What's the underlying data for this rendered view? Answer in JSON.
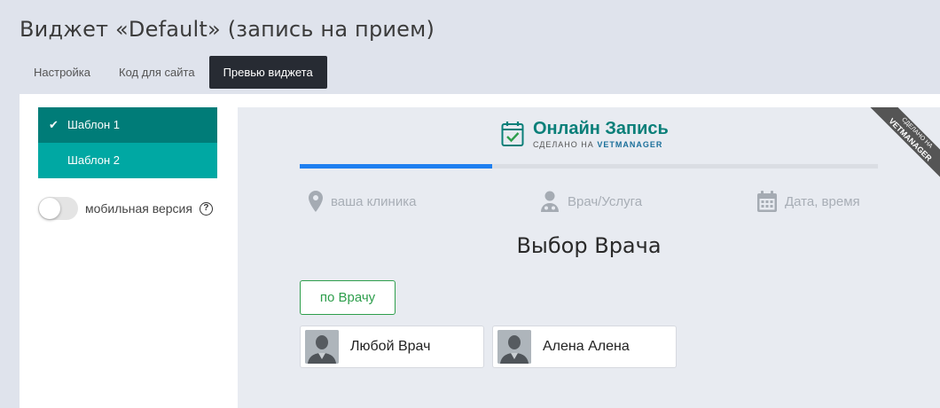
{
  "page": {
    "title": "Виджет «Default» (запись на прием)"
  },
  "tabs": [
    {
      "label": "Настройка"
    },
    {
      "label": "Код для сайта"
    },
    {
      "label": "Превью виджета"
    }
  ],
  "templates": [
    {
      "label": "Шаблон 1",
      "selected": true
    },
    {
      "label": "Шаблон 2",
      "selected": false
    }
  ],
  "mobile": {
    "label": "мобильная версия",
    "help": "?",
    "enabled": false
  },
  "widget": {
    "brand_title": "Онлайн Запись",
    "brand_sub_prefix": "СДЕЛАНО НА",
    "brand_sub_name": "VETMANAGER",
    "ribbon_line1": "СДЕЛАНО НА",
    "ribbon_line2": "VETMANAGER",
    "progress_fraction": 0.333,
    "steps": [
      {
        "label": "ваша клиника",
        "icon": "map-pin-icon"
      },
      {
        "label": "Врач/Услуга",
        "icon": "doctor-icon"
      },
      {
        "label": "Дата, время",
        "icon": "calendar-icon"
      }
    ],
    "section_title": "Выбор Врача",
    "filter_button": "по Врачу",
    "doctors": [
      {
        "name": "Любой Врач"
      },
      {
        "name": "Алена Алена"
      }
    ]
  },
  "colors": {
    "accent_teal_dark": "#007c78",
    "accent_teal": "#00a8a3",
    "progress_blue": "#1e7ff0",
    "filter_green": "#2e9e4c",
    "active_tab": "#272b33"
  }
}
